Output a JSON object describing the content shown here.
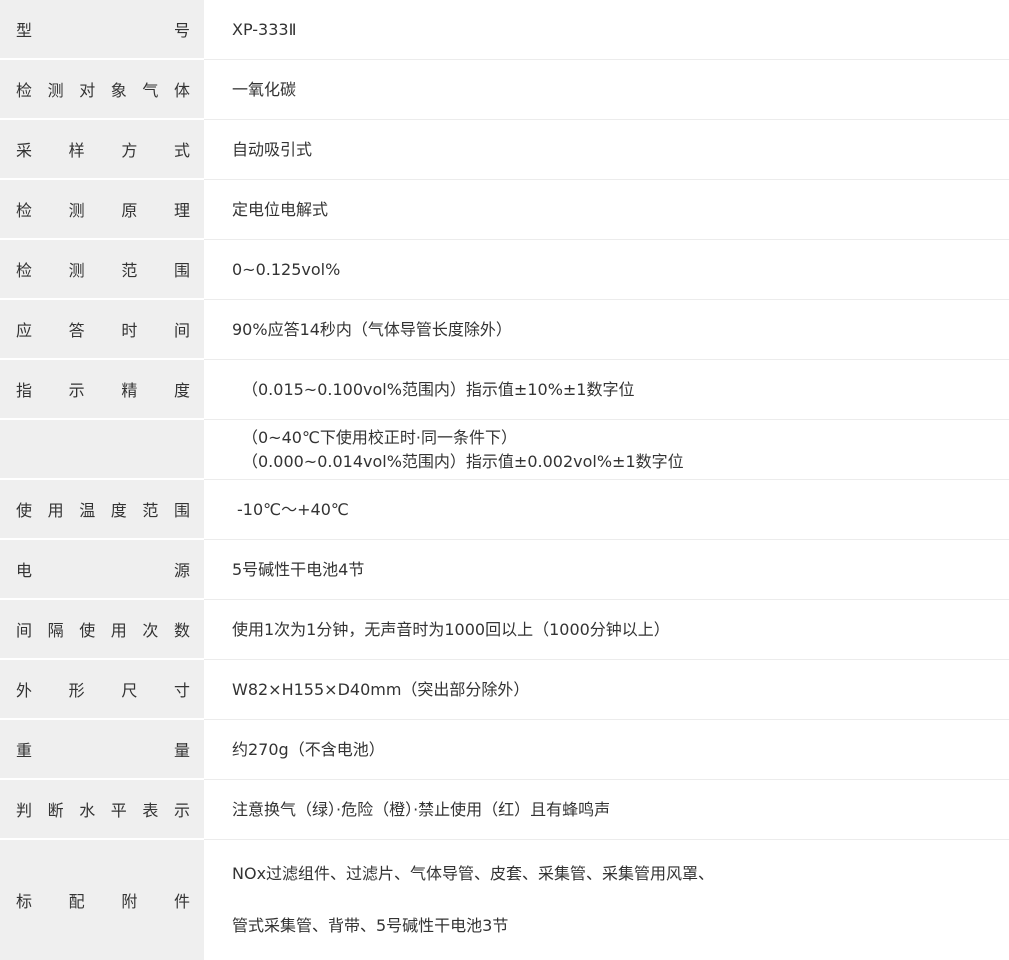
{
  "rows": [
    {
      "label": [
        "型",
        "号"
      ],
      "values": [
        "XP-333Ⅱ"
      ]
    },
    {
      "label": [
        "检",
        "测",
        "对",
        "象",
        "气",
        "体"
      ],
      "values": [
        "一氧化碳"
      ]
    },
    {
      "label": [
        "采",
        "样",
        "方",
        "式"
      ],
      "values": [
        "自动吸引式"
      ]
    },
    {
      "label": [
        "检",
        "测",
        "原",
        "理"
      ],
      "values": [
        "定电位电解式"
      ]
    },
    {
      "label": [
        "检",
        "测",
        "范",
        "围"
      ],
      "values": [
        "0~0.125vol%"
      ]
    },
    {
      "label": [
        "应",
        "答",
        "时",
        "间"
      ],
      "values": [
        "90%应答14秒内（气体导管长度除外）"
      ]
    },
    {
      "label": [
        "指",
        "示",
        "精",
        "度"
      ],
      "values": [
        "（0.015~0.100vol%范围内）指示值±10%±1数字位"
      ]
    },
    {
      "label": [],
      "values": [
        "（0~40℃下使用校正时·同一条件下）",
        "（0.000~0.014vol%范围内）指示值±0.002vol%±1数字位"
      ]
    },
    {
      "label": [
        "使",
        "用",
        "温",
        "度",
        "范",
        "围"
      ],
      "values": [
        "-10℃～+40℃"
      ]
    },
    {
      "label": [
        "电",
        "源"
      ],
      "values": [
        "5号碱性干电池4节"
      ]
    },
    {
      "label": [
        "间",
        "隔",
        "使",
        "用",
        "次",
        "数"
      ],
      "values": [
        "使用1次为1分钟，无声音时为1000回以上（1000分钟以上）"
      ]
    },
    {
      "label": [
        "外",
        "形",
        "尺",
        "寸"
      ],
      "values": [
        "W82×H155×D40mm（突出部分除外）"
      ]
    },
    {
      "label": [
        "重",
        "量"
      ],
      "values": [
        "约270g（不含电池）"
      ]
    },
    {
      "label": [
        "判",
        "断",
        "水",
        "平",
        "表",
        "示"
      ],
      "values": [
        "注意换气（绿）·危险（橙）·禁止使用（红）且有蜂鸣声"
      ]
    },
    {
      "label": [
        "标",
        "配",
        "附",
        "件"
      ],
      "values": [
        "NOx过滤组件、过滤片、气体导管、皮套、采集管、采集管用风罩、",
        "管式采集管、背带、5号碱性干电池3节"
      ]
    }
  ]
}
